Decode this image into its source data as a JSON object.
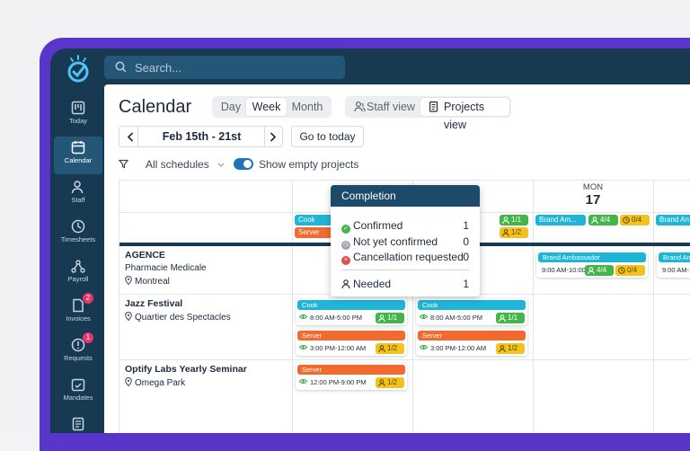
{
  "search": {
    "placeholder": "Search..."
  },
  "sidebar": {
    "items": [
      {
        "label": "Today"
      },
      {
        "label": "Calendar"
      },
      {
        "label": "Staff"
      },
      {
        "label": "Timesheets"
      },
      {
        "label": "Payroll"
      },
      {
        "label": "Invoices",
        "badge": "2"
      },
      {
        "label": "Requests",
        "badge": "1"
      },
      {
        "label": "Mandates"
      }
    ]
  },
  "header": {
    "title": "Calendar",
    "views": {
      "day": "Day",
      "week": "Week",
      "month": "Month",
      "selected": "Week"
    },
    "staff_view": "Staff view",
    "projects_view": "Projects view",
    "date_range": "Feb 15th - 21st",
    "go_today": "Go to today",
    "schedules": "All schedules",
    "show_empty": "Show empty projects"
  },
  "days": [
    {
      "dow": "MON",
      "num": "17"
    }
  ],
  "summary": {
    "col1": [
      {
        "label": "Cook",
        "color": "#1fb5d6"
      },
      {
        "label": "Server",
        "color": "#f26a2e"
      }
    ],
    "col2_badges": [
      "1/1",
      "1/2"
    ],
    "col3": {
      "label": "Brand Am...",
      "badges": [
        "4/4",
        "0/4"
      ]
    },
    "col4": {
      "label": "Brand An"
    }
  },
  "projects": [
    {
      "name": "AGENCE",
      "sub": "Pharmacie Medicale",
      "location": "Montreal"
    },
    {
      "name": "Jazz Festival",
      "location": "Quartier des Spectacles"
    },
    {
      "name": "Optify Labs Yearly Seminar",
      "location": "Omega Park"
    }
  ],
  "shifts": {
    "agence_mon": {
      "role": "Brand Ambassador",
      "time": "9:00 AM-10:00",
      "badges": [
        "4/4",
        "0/4"
      ]
    },
    "agence_next": {
      "role": "Brand Am",
      "time": "9:00 AM-1"
    },
    "jazz": [
      {
        "role": "Cook",
        "time": "8:00 AM-5:00 PM",
        "badge": "1/1"
      },
      {
        "role": "Server",
        "time": "3:00 PM-12:00 AM",
        "badge": "1/2"
      },
      {
        "role": "Cook",
        "time": "8:00 AM-5:00 PM",
        "badge": "1/1"
      },
      {
        "role": "Server",
        "time": "3:00 PM-12:00 AM",
        "badge": "1/2"
      }
    ],
    "optify": {
      "role": "Server",
      "time": "12:00 PM-9:00 PM",
      "badge": "1/2"
    }
  },
  "popup": {
    "title": "Completion",
    "rows": [
      {
        "label": "Confirmed",
        "value": "1"
      },
      {
        "label": "Not yet confirmed",
        "value": "0"
      },
      {
        "label": "Cancellation requested",
        "value": "0"
      }
    ],
    "needed_label": "Needed",
    "needed_value": "1"
  },
  "colors": {
    "cook": "#1fb5d6",
    "server": "#f26a2e",
    "brand": "#1fb5d6",
    "nav": "#173a52",
    "frame": "#5a35c9"
  }
}
